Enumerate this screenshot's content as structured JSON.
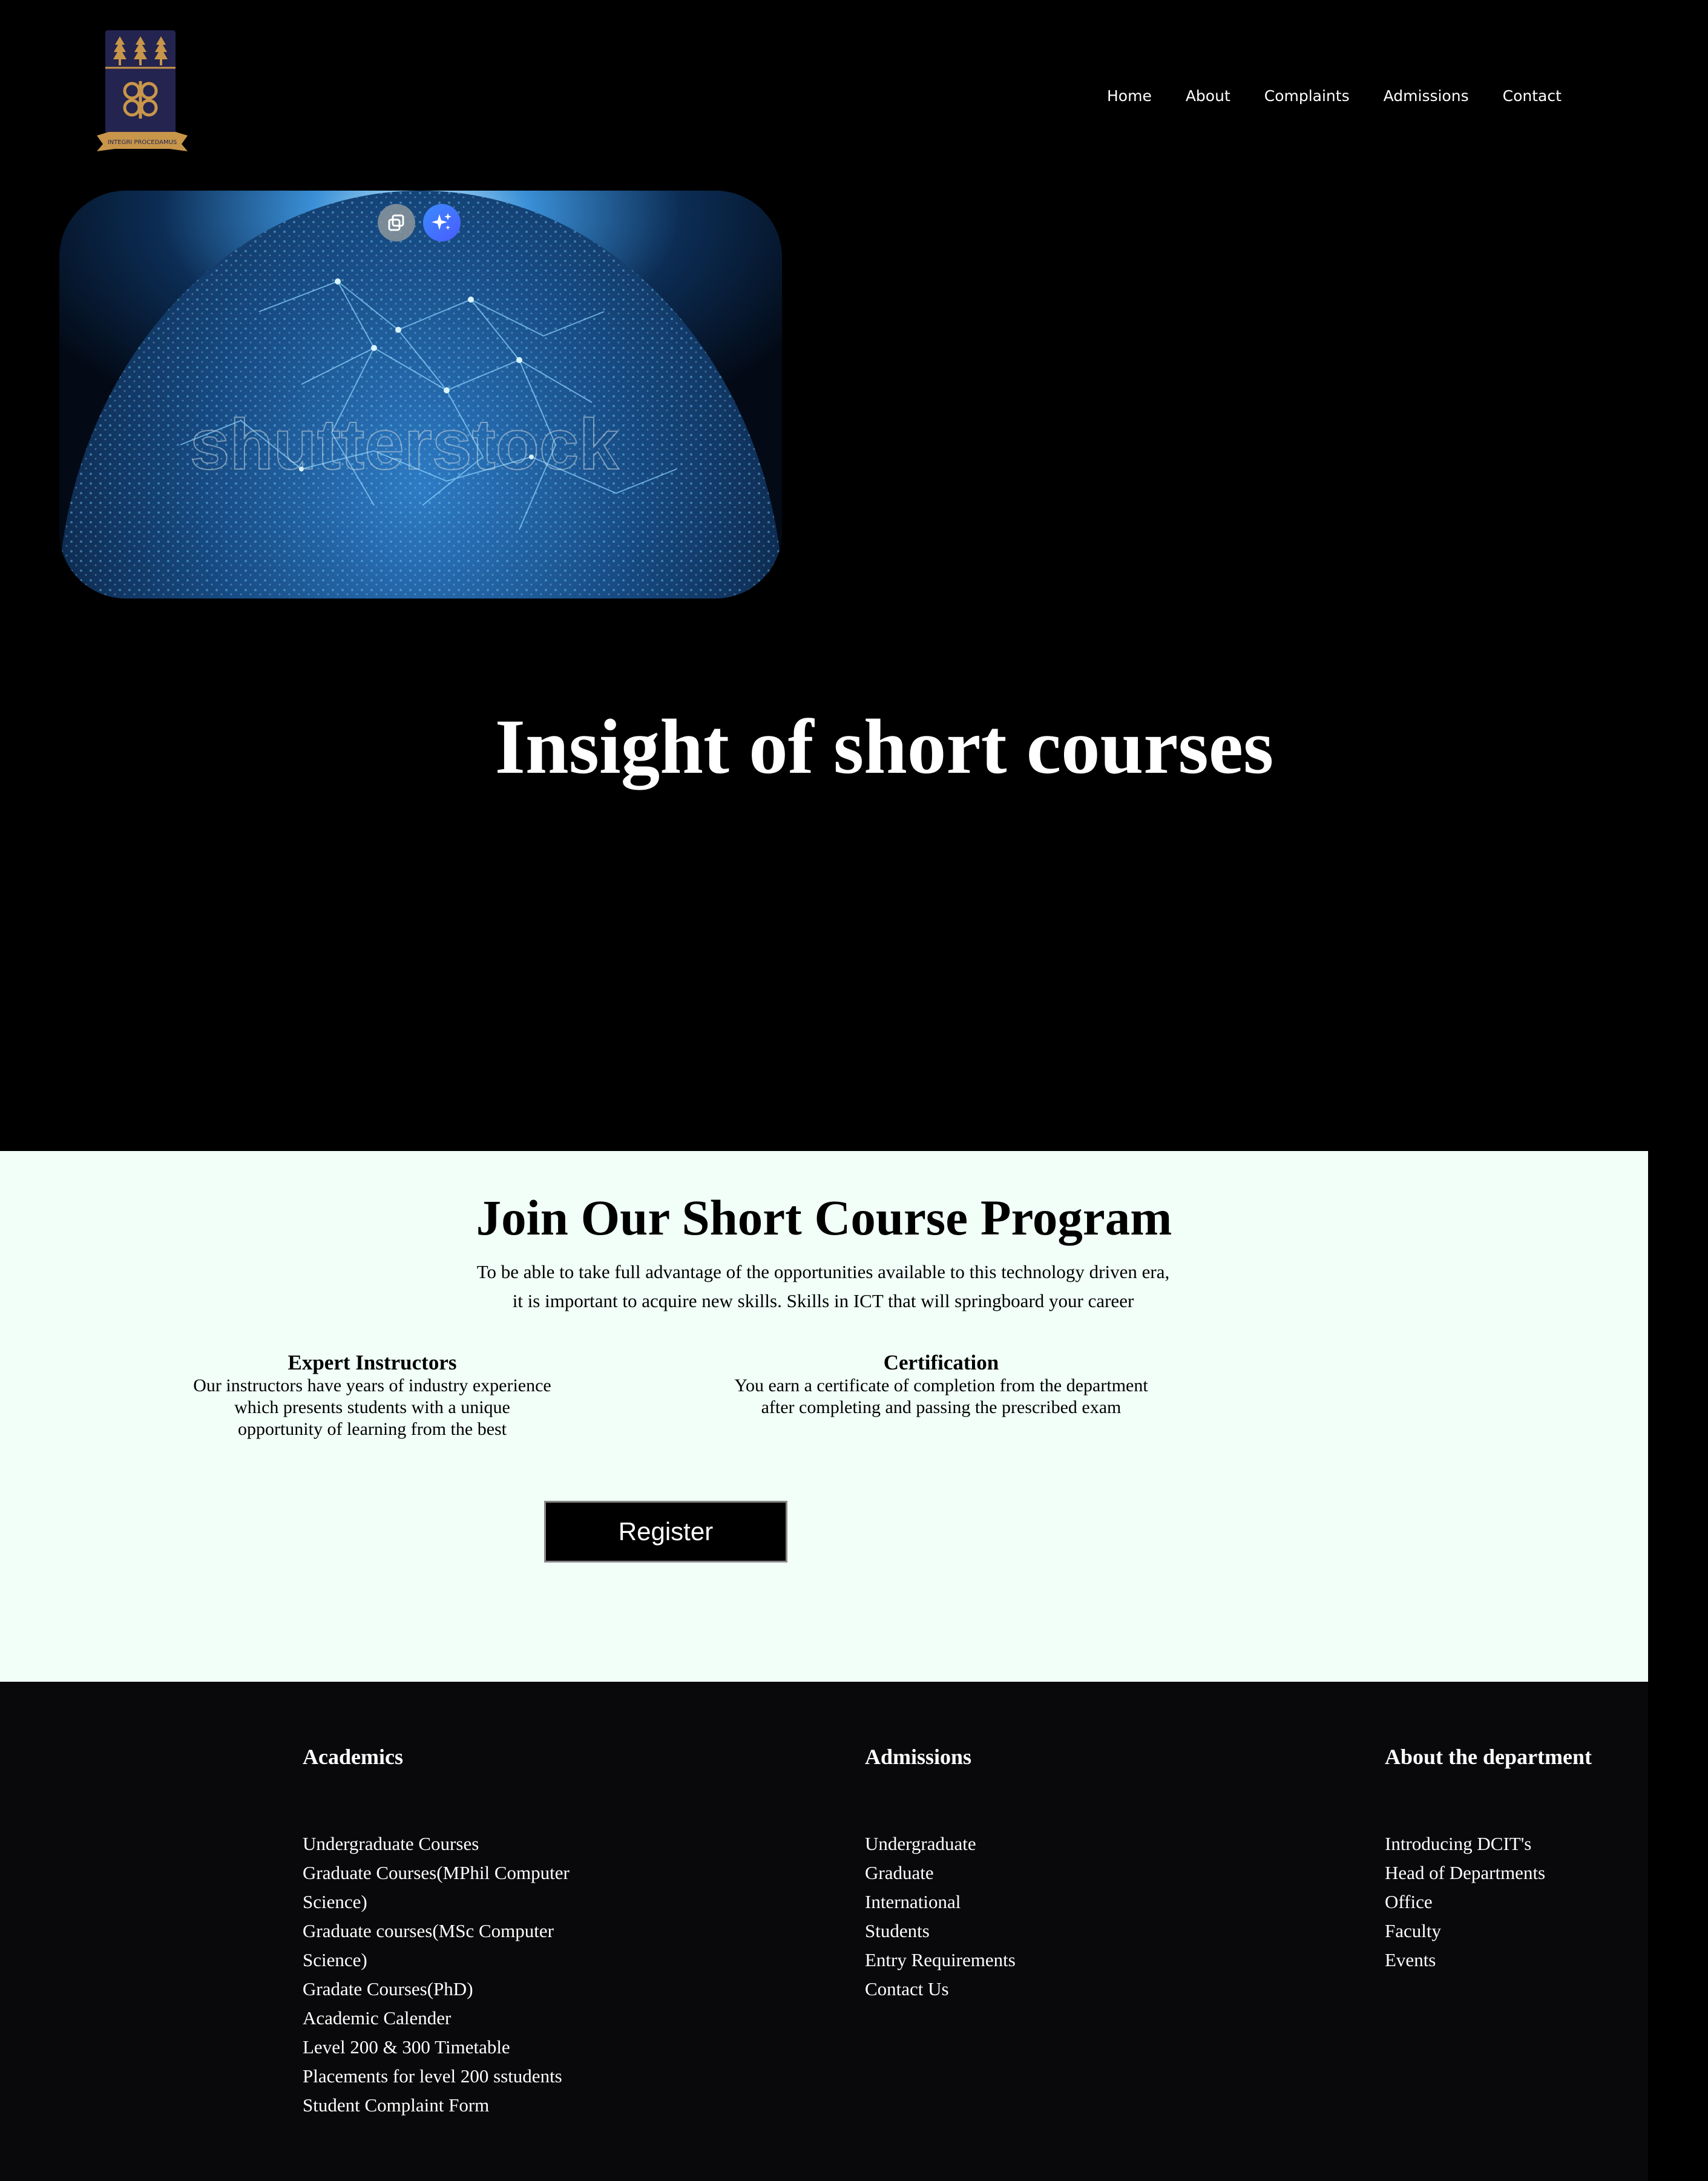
{
  "header": {
    "logo_motto": "INTEGRI PROCEDAMUS",
    "nav": [
      "Home",
      "About",
      "Complaints",
      "Admissions",
      "Contact"
    ]
  },
  "hero": {
    "watermark": "shutterstock",
    "title": "Insight of short courses"
  },
  "join": {
    "title": "Join Our Short Course Program",
    "description_line1": "To be able to take full advantage of the opportunities available to this technology driven era,",
    "description_line2": "it is important to acquire new skills. Skills in ICT that will springboard your career",
    "features": [
      {
        "title": "Expert Instructors",
        "lines": [
          "Our instructors have years of industry experience",
          "which presents students with a unique",
          "opportunity of learning from the best"
        ]
      },
      {
        "title": "Certification",
        "lines": [
          "You earn a certificate of completion from the department",
          "after completing and passing the prescribed exam"
        ]
      }
    ],
    "register_label": "Register"
  },
  "footer": {
    "academics": {
      "heading": "Academics",
      "items": [
        "Undergraduate Courses",
        "Graduate Courses(MPhil Computer Science)",
        "Graduate courses(MSc Computer Science)",
        "Gradate Courses(PhD)",
        "Academic Calender",
        "Level 200 & 300 Timetable",
        "Placements for level 200 sstudents",
        "Student Complaint Form"
      ]
    },
    "admissions": {
      "heading": "Admissions",
      "items": [
        "Undergraduate",
        "Graduate",
        "International",
        "Students",
        "Entry Requirements",
        "Contact Us"
      ]
    },
    "about": {
      "heading": "About the department",
      "items": [
        "Introducing DCIT's",
        "Head of Departments",
        "Office",
        "Faculty",
        "Events"
      ]
    }
  },
  "colors": {
    "background": "#000000",
    "join_bg": "#f1fff8",
    "footer_bg": "#09090b",
    "logo_navy": "#23244f",
    "logo_gold": "#c8964a"
  },
  "icons": {
    "copy_button": "copy-image-icon",
    "magic_button": "sparkles-icon"
  }
}
